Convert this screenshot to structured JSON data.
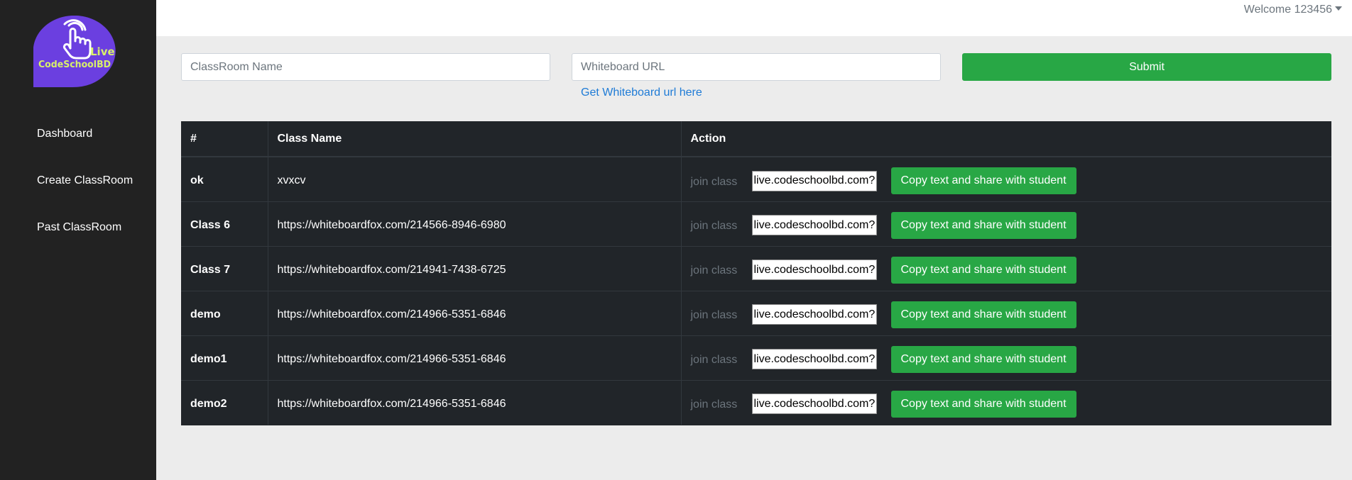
{
  "brand": {
    "name": "CodeSchoolBD",
    "badge": "Live",
    "bg_color": "#6b3fe0",
    "name_color": "#d8f06a",
    "icon": "pointer-hand-icon"
  },
  "sidebar": {
    "items": [
      {
        "label": "Dashboard"
      },
      {
        "label": "Create ClassRoom"
      },
      {
        "label": "Past ClassRoom"
      }
    ]
  },
  "header": {
    "welcome": "Welcome 123456",
    "caret_icon": "caret-down-icon"
  },
  "form": {
    "classroom_placeholder": "ClassRoom Name",
    "whiteboard_placeholder": "Whiteboard URL",
    "submit_label": "Submit",
    "whiteboard_link": "Get Whiteboard url here"
  },
  "table": {
    "headers": [
      "#",
      "Class Name",
      "Action"
    ],
    "join_label": "join class",
    "copy_label": "Copy text and share with student",
    "share_value": "live.codeschoolbd.com?c",
    "rows": [
      {
        "id": "ok",
        "name": "xvxcv"
      },
      {
        "id": "Class 6",
        "name": "https://whiteboardfox.com/214566-8946-6980"
      },
      {
        "id": "Class 7",
        "name": "https://whiteboardfox.com/214941-7438-6725"
      },
      {
        "id": "demo",
        "name": "https://whiteboardfox.com/214966-5351-6846"
      },
      {
        "id": "demo1",
        "name": "https://whiteboardfox.com/214966-5351-6846"
      },
      {
        "id": "demo2",
        "name": "https://whiteboardfox.com/214966-5351-6846"
      }
    ]
  },
  "colors": {
    "sidebar": "#222222",
    "accent_green": "#28a745",
    "link_blue": "#1e7bd6",
    "table_dark": "#212529"
  }
}
